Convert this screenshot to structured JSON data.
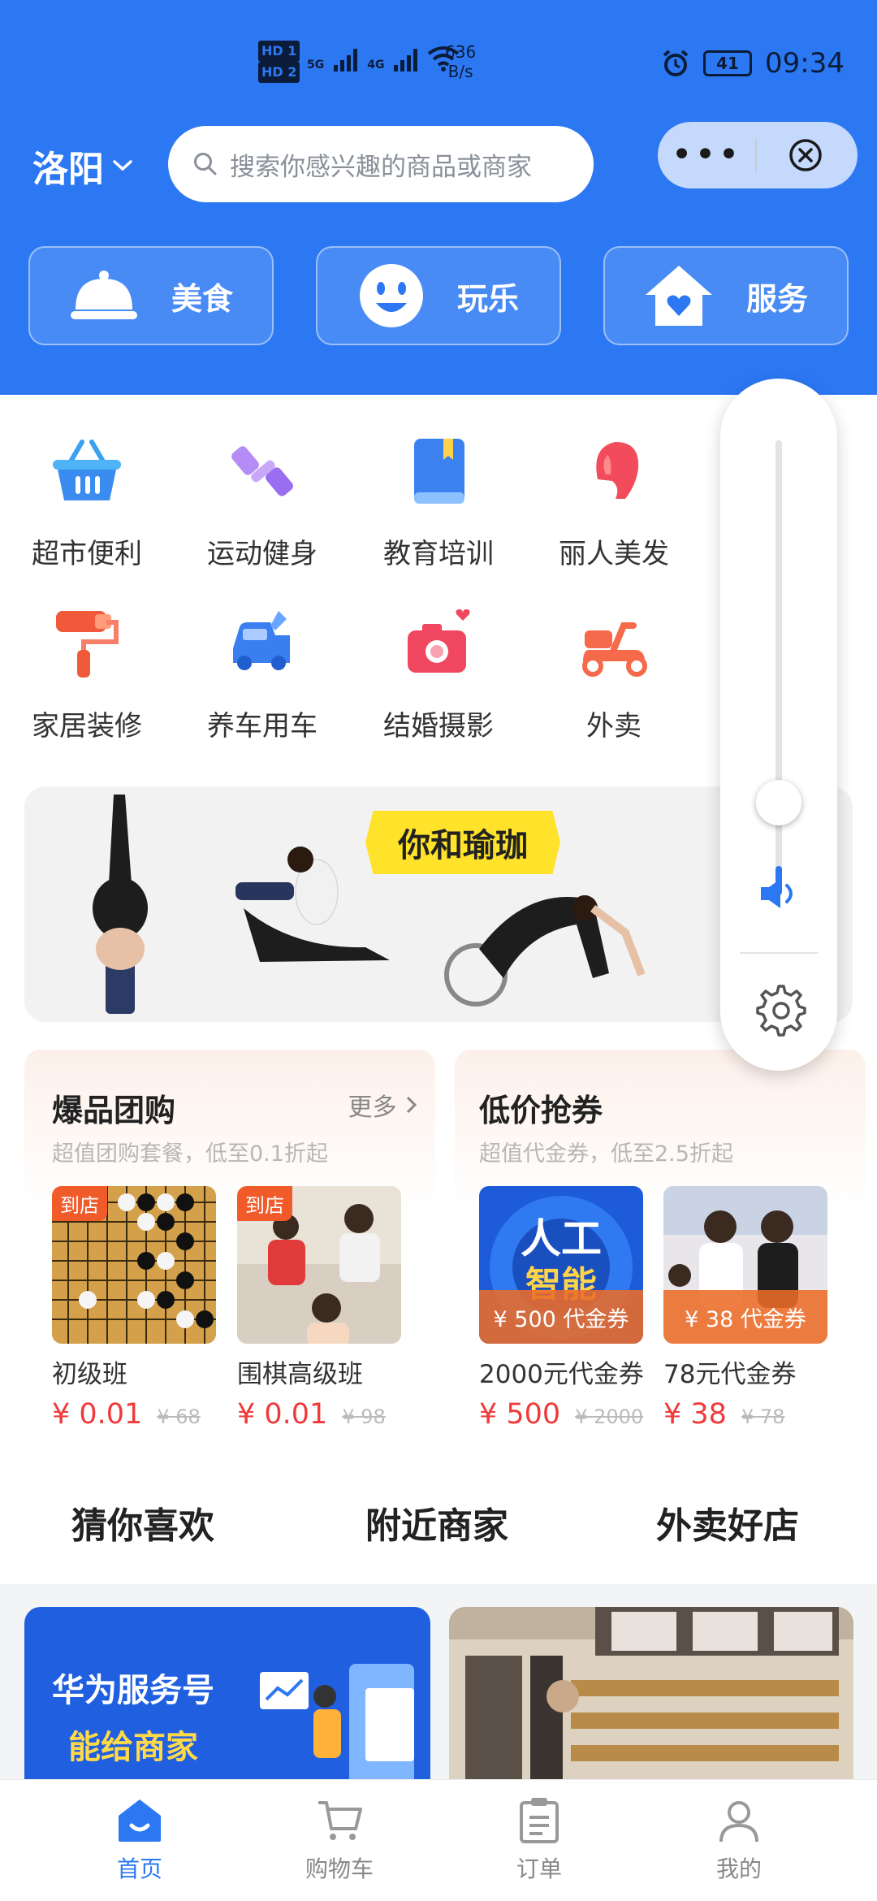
{
  "status_bar": {
    "hd1": "HD 1",
    "hd2": "HD 2",
    "net_5g": "5G",
    "net_4g": "4G",
    "speed_value": "636",
    "speed_unit": "B/s",
    "battery": "41",
    "time": "09:34"
  },
  "header": {
    "city": "洛阳",
    "search_placeholder": "搜索你感兴趣的商品或商家",
    "more_label": "•••"
  },
  "quick_categories": [
    {
      "label": "美食",
      "icon": "food-cloche-icon"
    },
    {
      "label": "玩乐",
      "icon": "smiley-face-icon"
    },
    {
      "label": "服务",
      "icon": "house-heart-icon"
    }
  ],
  "categories": [
    {
      "label": "超市便利",
      "icon": "shopping-basket-icon"
    },
    {
      "label": "运动健身",
      "icon": "dumbbell-icon"
    },
    {
      "label": "教育培训",
      "icon": "book-icon"
    },
    {
      "label": "丽人美发",
      "icon": "woman-hair-icon"
    },
    {
      "label": "家居装修",
      "icon": "paint-roller-icon"
    },
    {
      "label": "养车用车",
      "icon": "car-wrench-icon"
    },
    {
      "label": "结婚摄影",
      "icon": "camera-heart-icon"
    },
    {
      "label": "外卖",
      "icon": "scooter-icon"
    }
  ],
  "banner": {
    "title": "你和瑜珈"
  },
  "group_buy": {
    "title": "爆品团购",
    "more": "更多",
    "subtitle": "超值团购套餐，低至0.1折起",
    "items": [
      {
        "tag": "到店",
        "name": "初级班",
        "price": "¥ 0.01",
        "original": "¥ 68"
      },
      {
        "tag": "到店",
        "name": "围棋高级班",
        "price": "¥ 0.01",
        "original": "¥ 98"
      }
    ]
  },
  "coupons": {
    "title": "低价抢券",
    "subtitle": "超值代金券，低至2.5折起",
    "items": [
      {
        "overlay": "¥ 500 代金券",
        "name": "2000元代金券",
        "price": "¥ 500",
        "original": "¥ 2000",
        "img_text_1": "人工",
        "img_text_2": "智能"
      },
      {
        "overlay": "¥ 38 代金券",
        "name": "78元代金券",
        "price": "¥ 38",
        "original": "¥ 78"
      }
    ]
  },
  "feed_tabs": [
    {
      "label": "猜你喜欢",
      "active": true
    },
    {
      "label": "附近商家",
      "active": false
    },
    {
      "label": "外卖好店",
      "active": false
    }
  ],
  "feed_cards": [
    {
      "line1": "华为服务号",
      "line2": "能给商家"
    },
    {
      "line1": ""
    }
  ],
  "bottom_nav": [
    {
      "label": "首页",
      "icon": "home-icon",
      "active": true
    },
    {
      "label": "购物车",
      "icon": "cart-icon",
      "active": false
    },
    {
      "label": "订单",
      "icon": "order-icon",
      "active": false
    },
    {
      "label": "我的",
      "icon": "profile-icon",
      "active": false
    }
  ],
  "colors": {
    "brand_blue": "#2c78f3",
    "price_red": "#ef3a3a",
    "tab_highlight": "#ffcc33"
  }
}
